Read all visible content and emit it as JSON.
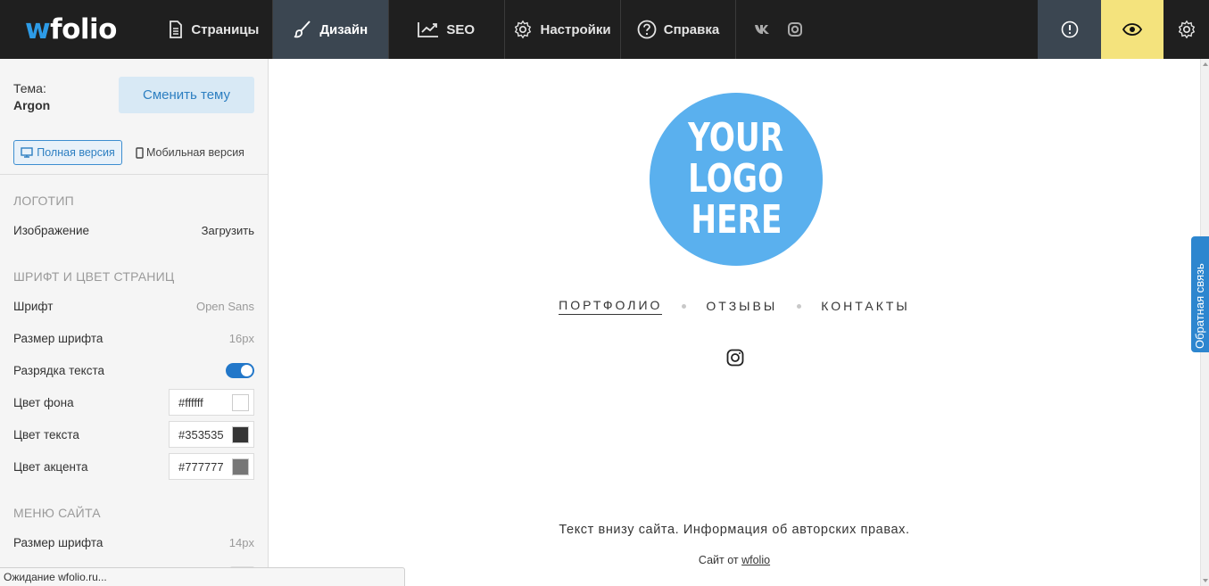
{
  "brand": {
    "w": "w",
    "rest": "folio"
  },
  "nav": {
    "pages": "Страницы",
    "design": "Дизайн",
    "seo": "SEO",
    "settings": "Настройки",
    "help": "Справка",
    "social_vk": "vk-icon",
    "social_ig": "instagram-icon"
  },
  "sidebar": {
    "theme_label": "Тема:",
    "theme_name": "Argon",
    "change_theme": "Сменить тему",
    "version_full": "Полная версия",
    "version_mobile": "Мобильная версия",
    "logo_section": "Логотип",
    "image_label": "Изображение",
    "upload": "Загрузить",
    "font_section": "Шрифт и цвет страниц",
    "font_label": "Шрифт",
    "font_value": "Open Sans",
    "font_size_label": "Размер шрифта",
    "font_size_value": "16px",
    "letter_spacing_label": "Разрядка текста",
    "letter_spacing_on": true,
    "bg_color_label": "Цвет фона",
    "bg_color": "#ffffff",
    "text_color_label": "Цвет текста",
    "text_color": "#353535",
    "accent_color_label": "Цвет акцента",
    "accent_color": "#777777",
    "menu_section": "Меню сайта",
    "menu_font_size_label": "Размер шрифта",
    "menu_font_size_value": "14px"
  },
  "preview": {
    "logo_lines": [
      "YOUR",
      "LOGO",
      "HERE"
    ],
    "menu": [
      "ПОРТФОЛИО",
      "ОТЗЫВЫ",
      "КОНТАКТЫ"
    ],
    "active_menu": "ПОРТФОЛИО",
    "footer_text": "Текст внизу сайта. Информация об авторских правах.",
    "credit_prefix": "Сайт от",
    "credit_link": "wfolio"
  },
  "colors": {
    "topbar": "#1f1f1f",
    "design_active": "#3b4651",
    "preview_btn": "#f4e37d",
    "accent_blue": "#2d86cf",
    "logo_circle": "#5ab0ee"
  },
  "feedback_tab": "Обратная связь",
  "status": "Ожидание wfolio.ru..."
}
